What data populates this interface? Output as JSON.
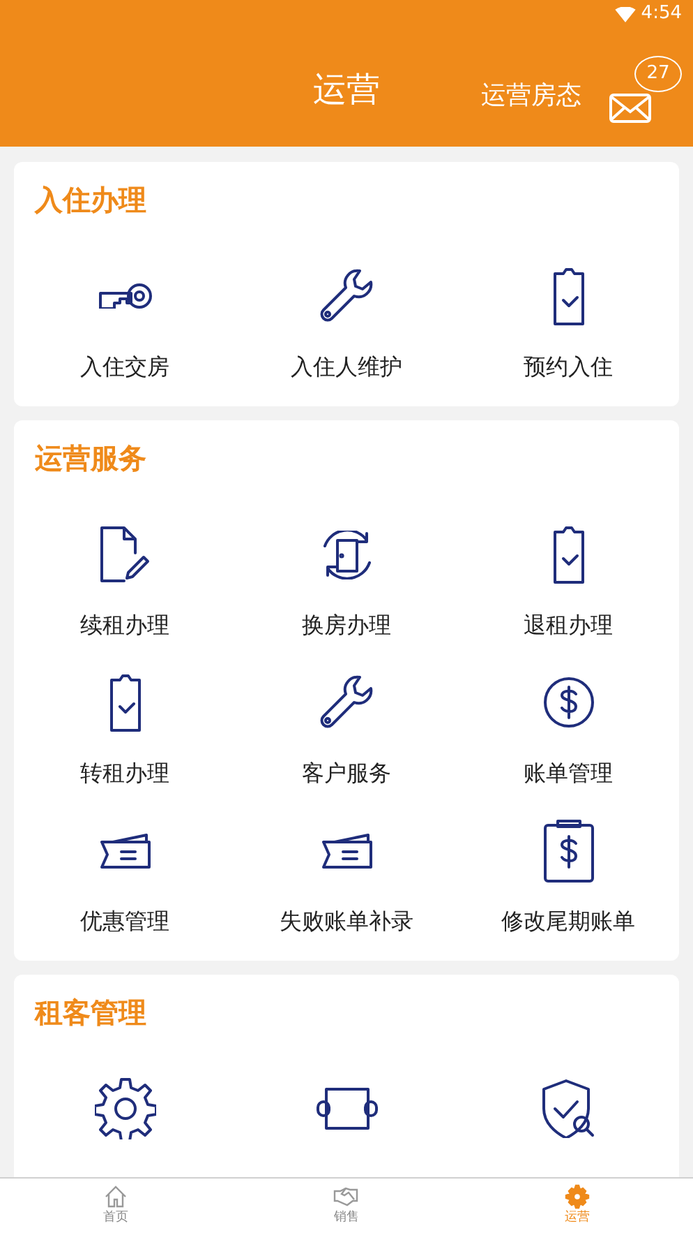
{
  "status_bar": {
    "time": "4:54"
  },
  "header": {
    "title": "运营",
    "link": "运营房态",
    "mail_badge": "27"
  },
  "sections": [
    {
      "title": "入住办理",
      "items": [
        "入住交房",
        "入住人维护",
        "预约入住"
      ]
    },
    {
      "title": "运营服务",
      "items": [
        "续租办理",
        "换房办理",
        "退租办理",
        "转租办理",
        "客户服务",
        "账单管理",
        "优惠管理",
        "失败账单补录",
        "修改尾期账单"
      ]
    },
    {
      "title": "租客管理"
    }
  ],
  "bottom_nav": [
    {
      "label": "首页",
      "selected": false
    },
    {
      "label": "销售",
      "selected": false
    },
    {
      "label": "运营",
      "selected": true
    }
  ]
}
